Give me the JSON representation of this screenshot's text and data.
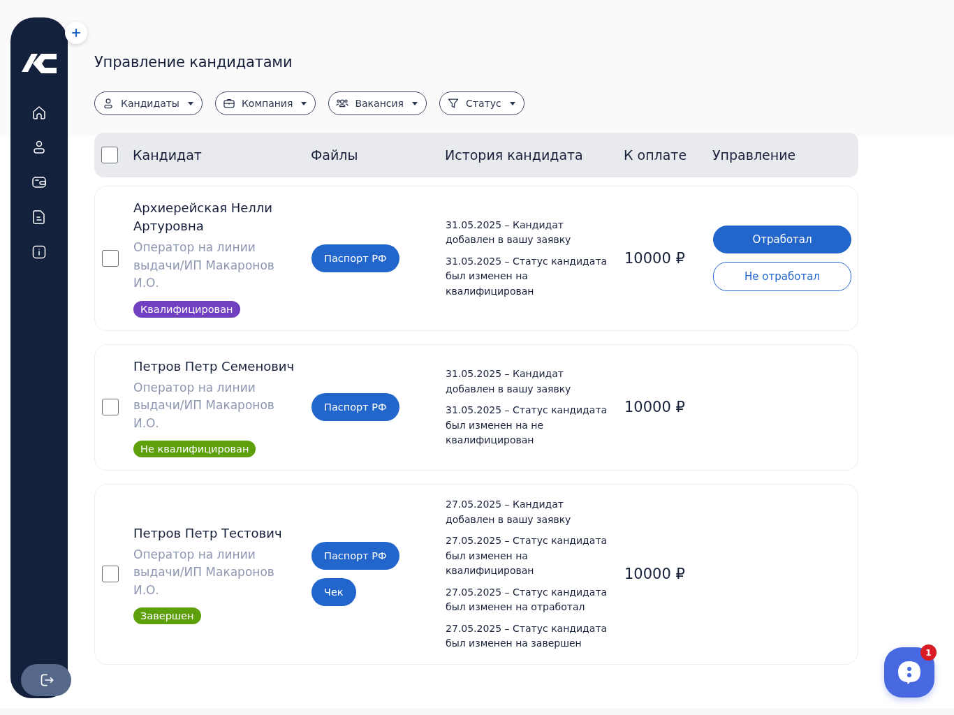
{
  "page_title": "Управление кандидатами",
  "filters": [
    {
      "label": "Кандидаты"
    },
    {
      "label": "Компания"
    },
    {
      "label": "Вакансия"
    },
    {
      "label": "Статус"
    }
  ],
  "table": {
    "select_all_checked": false,
    "columns": [
      "Кандидат",
      "Файлы",
      "История кандидата",
      "К оплате",
      "Управление"
    ],
    "rows": [
      {
        "checked": false,
        "name": "Архиерейская Нелли Артуровна",
        "position": "Оператор на линии выдачи/ИП Макаронов И.О.",
        "status": {
          "label": "Квалифицирован",
          "color": "#7040c0"
        },
        "files": [
          "Паспорт РФ"
        ],
        "history": [
          "31.05.2025 – Кандидат добавлен в вашу заявку",
          "31.05.2025 – Статус кандидата был изменен на квалифицирован"
        ],
        "payment": "10000 ₽",
        "actions": [
          {
            "label": "Отработал",
            "kind": "primary"
          },
          {
            "label": "Не отработал",
            "kind": "outline"
          }
        ]
      },
      {
        "checked": false,
        "name": "Петров Петр Семенович",
        "position": "Оператор на линии выдачи/ИП Макаронов И.О.",
        "status": {
          "label": "Не квалифицирован",
          "color": "#5ea00c"
        },
        "files": [
          "Паспорт РФ"
        ],
        "history": [
          "31.05.2025 – Кандидат добавлен в вашу заявку",
          "31.05.2025 – Статус кандидата был изменен на не квалифицирован"
        ],
        "payment": "10000 ₽"
      },
      {
        "checked": false,
        "name": "Петров Петр Тестович",
        "position": "Оператор на линии выдачи/ИП Макаронов И.О.",
        "status": {
          "label": "Завершен",
          "color": "#5ea00c"
        },
        "files": [
          "Паспорт РФ",
          "Чек"
        ],
        "history": [
          "27.05.2025 – Кандидат добавлен в вашу заявку",
          "27.05.2025 – Статус кандидата был изменен на квалифицирован",
          "27.05.2025 – Статус кандидата был изменен на отработал",
          "27.05.2025 – Статус кандидата был изменен на завершен"
        ],
        "payment": "10000 ₽"
      }
    ]
  },
  "chat_badge": "1"
}
